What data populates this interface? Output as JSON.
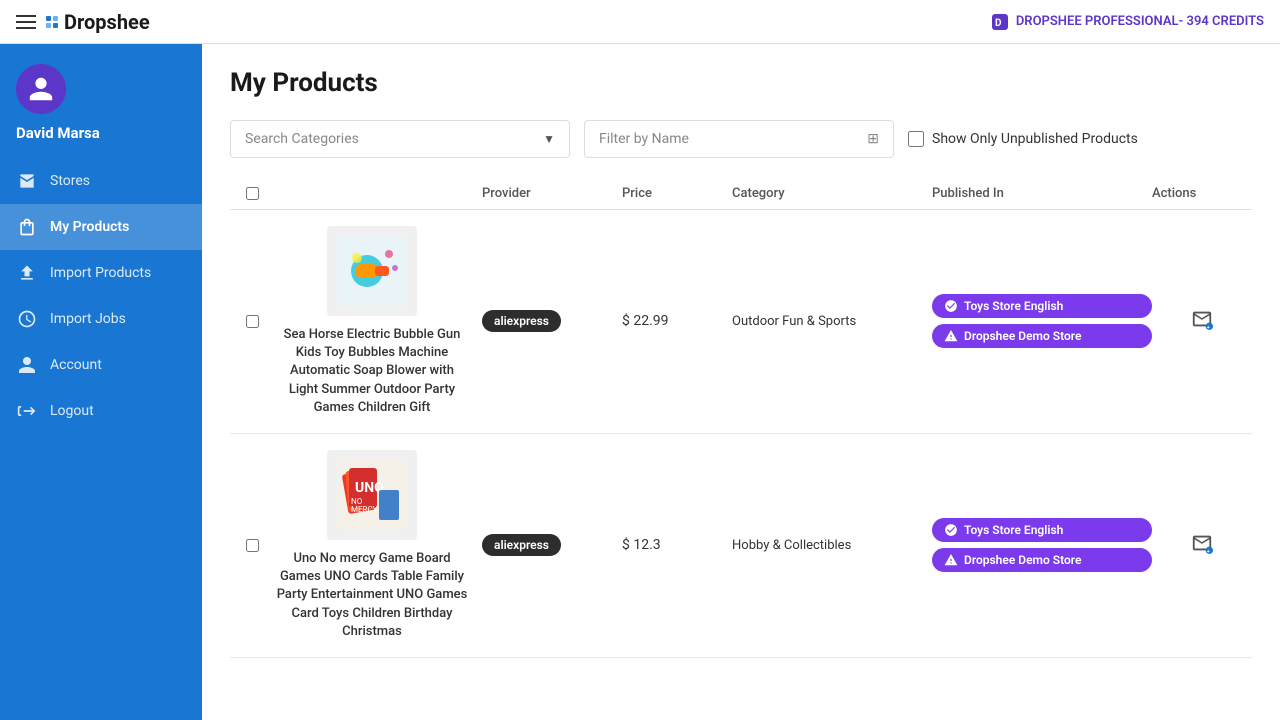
{
  "topbar": {
    "logo_text": "Dropshee",
    "plan_text": "DROPSHEE PROFESSIONAL",
    "credits": "394 CREDITS"
  },
  "sidebar": {
    "username": "David Marsa",
    "nav_items": [
      {
        "id": "stores",
        "label": "Stores",
        "icon": "store-icon",
        "active": false
      },
      {
        "id": "my-products",
        "label": "My Products",
        "icon": "bag-icon",
        "active": true
      },
      {
        "id": "import-products",
        "label": "Import Products",
        "icon": "upload-icon",
        "active": false
      },
      {
        "id": "import-jobs",
        "label": "Import Jobs",
        "icon": "jobs-icon",
        "active": false
      },
      {
        "id": "account",
        "label": "Account",
        "icon": "account-icon",
        "active": false
      },
      {
        "id": "logout",
        "label": "Logout",
        "icon": "logout-icon",
        "active": false
      }
    ]
  },
  "main": {
    "page_title": "My Products",
    "filters": {
      "search_categories_placeholder": "Search Categories",
      "filter_by_name_placeholder": "Filter by Name",
      "show_unpublished_label": "Show Only Unpublished Products"
    },
    "table": {
      "columns": [
        "",
        "",
        "Provider",
        "Price",
        "Category",
        "Published In",
        "Actions"
      ],
      "rows": [
        {
          "name": "Sea Horse Electric Bubble Gun Kids Toy Bubbles Machine Automatic Soap Blower with Light Summer Outdoor Party Games Children Gift",
          "provider": "aliexpress",
          "price": "$ 22.99",
          "category": "Outdoor Fun & Sports",
          "published": [
            {
              "label": "Toys Store English",
              "type": "published"
            },
            {
              "label": "Dropshee Demo Store",
              "type": "warning"
            }
          ]
        },
        {
          "name": "Uno No mercy Game Board Games UNO Cards Table Family Party Entertainment UNO Games Card Toys Children Birthday Christmas",
          "provider": "aliexpress",
          "price": "$ 12.3",
          "category": "Hobby & Collectibles",
          "published": [
            {
              "label": "Toys Store English",
              "type": "published"
            },
            {
              "label": "Dropshee Demo Store",
              "type": "warning"
            }
          ]
        }
      ]
    }
  }
}
